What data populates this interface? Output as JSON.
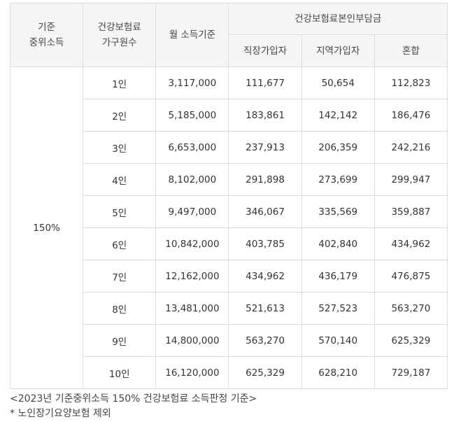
{
  "headers": {
    "median_income": "기준\n중위소득",
    "household_size": "건강보험료\n가구원수",
    "monthly_income": "월 소득기준",
    "premium_group": "건강보험료본인부담금",
    "employee": "직장가입자",
    "regional": "지역가입자",
    "mixed": "혼합"
  },
  "median_ratio": "150%",
  "rows": [
    {
      "size": "1인",
      "income": "3,117,000",
      "employee": "111,677",
      "regional": "50,654",
      "mixed": "112,823"
    },
    {
      "size": "2인",
      "income": "5,185,000",
      "employee": "183,861",
      "regional": "142,142",
      "mixed": "186,476"
    },
    {
      "size": "3인",
      "income": "6,653,000",
      "employee": "237,913",
      "regional": "206,359",
      "mixed": "242,216"
    },
    {
      "size": "4인",
      "income": "8,102,000",
      "employee": "291,898",
      "regional": "273,699",
      "mixed": "299,947"
    },
    {
      "size": "5인",
      "income": "9,497,000",
      "employee": "346,067",
      "regional": "335,569",
      "mixed": "359,887"
    },
    {
      "size": "6인",
      "income": "10,842,000",
      "employee": "403,785",
      "regional": "402,840",
      "mixed": "434,962"
    },
    {
      "size": "7인",
      "income": "12,162,000",
      "employee": "434,962",
      "regional": "436,179",
      "mixed": "476,875"
    },
    {
      "size": "8인",
      "income": "13,481,000",
      "employee": "521,613",
      "regional": "527,523",
      "mixed": "563,270"
    },
    {
      "size": "9인",
      "income": "14,800,000",
      "employee": "563,270",
      "regional": "570,140",
      "mixed": "625,329"
    },
    {
      "size": "10인",
      "income": "16,120,000",
      "employee": "625,329",
      "regional": "628,210",
      "mixed": "729,187"
    }
  ],
  "notes": {
    "caption": "<2023년 기준중위소득 150% 건강보험료 소득판정 기준>",
    "footnote": "* 노인장기요양보험 제외"
  }
}
